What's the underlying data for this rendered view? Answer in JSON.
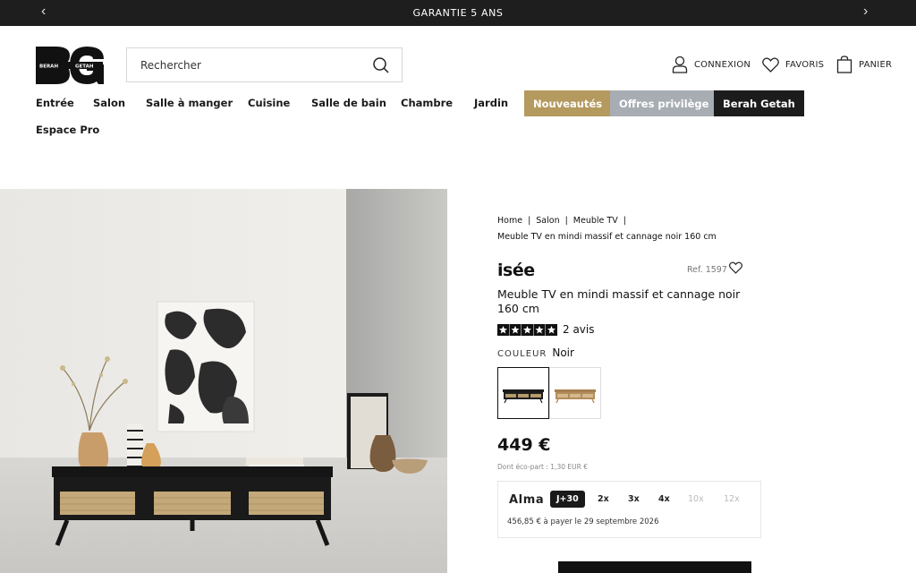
{
  "topbar": {
    "message": "GARANTIE 5 ANS",
    "prev_icon": "chevron-left-icon",
    "next_icon": "chevron-right-icon"
  },
  "header": {
    "logo": {
      "letters": "BG",
      "text_left": "BERAH",
      "text_right": "GETAH"
    },
    "search_placeholder": "Rechercher",
    "login_label": "CONNEXION",
    "favorites_label": "FAVORIS",
    "cart_label": "PANIER"
  },
  "nav": {
    "items": [
      "Entrée",
      "Salon",
      "Salle à manger",
      "Cuisine",
      "Salle de bain",
      "Chambre",
      "Jardin"
    ],
    "nouveautes": "Nouveautés",
    "offres": "Offres privilège",
    "berah": "Berah Getah",
    "espace_pro": "Espace Pro",
    "colors": {
      "nouveautes": "#b59a5f",
      "offres": "#a7adb3",
      "berah": "#1c1c1c"
    }
  },
  "breadcrumb": {
    "home": "Home",
    "salon": "Salon",
    "meuble_tv": "Meuble TV",
    "current": "Meuble TV en mindi massif et cannage noir 160 cm"
  },
  "product": {
    "brand": "isée",
    "ref": "Ref. 1597",
    "title": "Meuble TV en mindi massif et cannage noir 160 cm",
    "rating": 5,
    "reviews": "2 avis",
    "color_label": "COULEUR",
    "color_value": "Noir",
    "swatches": [
      "Noir",
      "Naturel"
    ],
    "price": "449 €",
    "eco_part": "Dont éco-part : 1,30 EUR €"
  },
  "alma": {
    "logo": "Alma",
    "options": [
      "J+30",
      "2x",
      "3x",
      "4x",
      "10x",
      "12x"
    ],
    "active": "J+30",
    "note": "456,85 € à payer le 29 septembre 2026"
  }
}
